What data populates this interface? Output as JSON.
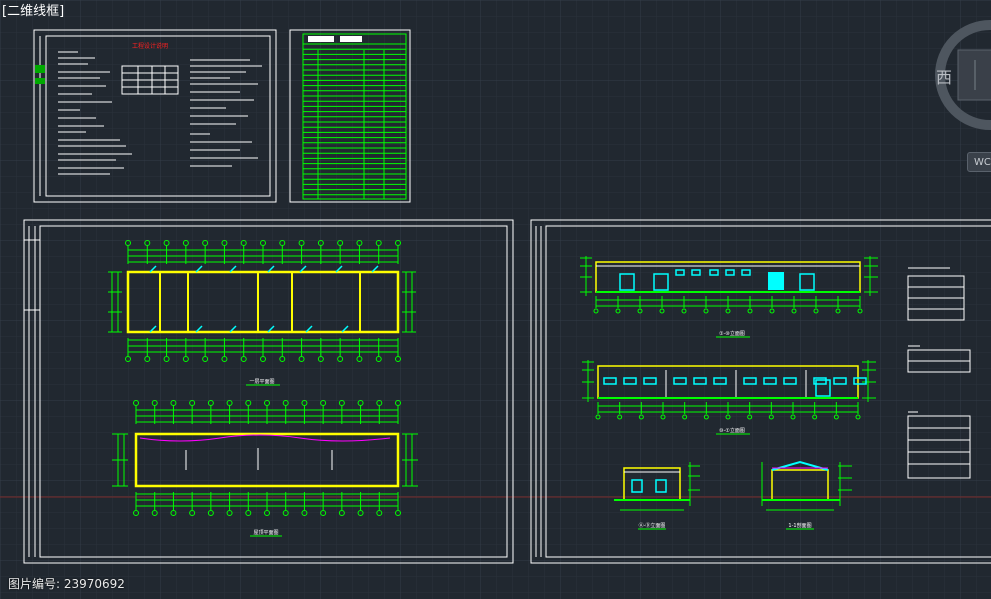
{
  "viewport": {
    "view_label": "[二维线框]",
    "background": "#212830",
    "grid_color": "#2c343e"
  },
  "viewcube": {
    "direction_label": "西",
    "wcs_label": "WCS"
  },
  "sheets": {
    "notes_sheet_title": "工程设计说明",
    "plan_label_1": "一层平面图",
    "plan_label_2": "屋顶平面图",
    "elevation_label_1": "①-⑩立面图",
    "elevation_label_2": "⑩-①立面图",
    "elevation_label_3": "Ⓐ-Ⓓ立面图",
    "section_label": "1-1剖面图"
  },
  "colors": {
    "frame": "#ffffff",
    "green": "#00ff00",
    "yellow": "#ffff00",
    "cyan": "#00ffff",
    "red": "#ff2020",
    "magenta": "#ff00ff"
  },
  "watermark": "图片编号: 23970692"
}
